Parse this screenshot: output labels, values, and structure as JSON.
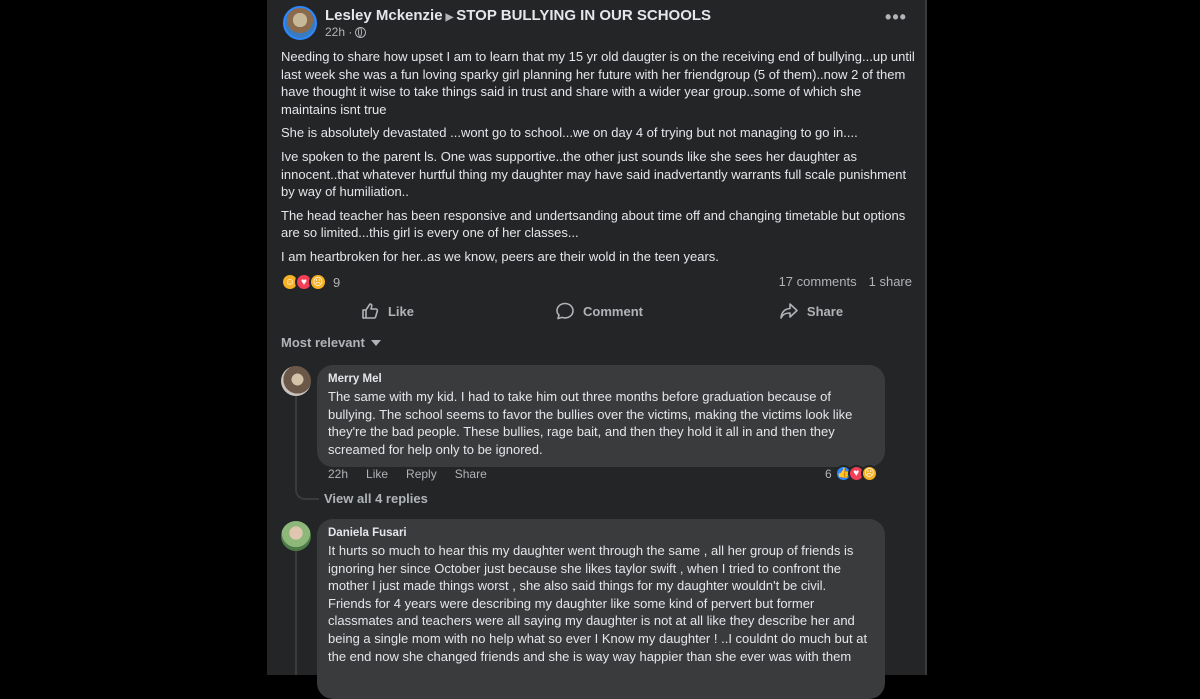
{
  "post": {
    "author": "Lesley Mckenzie",
    "group": "STOP BULLYING IN OUR SCHOOLS",
    "time": "22h ·",
    "paragraphs": [
      "Needing to share how upset I am to learn that my 15 yr old daugter is on the receiving end of bullying...up until last week she was a fun loving sparky girl planning her future with her friendgroup (5 of them)..now 2 of them have thought it wise to take things said in trust and share with a wider year group..some of which she maintains isnt true",
      "She is absolutely devastated  ...wont go to school...we on day 4 of trying but not managing to go in....",
      "Ive spoken to the parent ls. One was supportive..the other just sounds like she sees her daughter as innocent..that whatever hurtful thing my daughter may have said inadvertantly warrants full scale punishment by way of humiliation..",
      "The head teacher has been responsive and  undertsanding about time off and changing timetable but options are so limited...this girl is every one of her classes...",
      "I am heartbroken for her..as we know, peers are their wold in the teen years."
    ],
    "reaction_count": "9",
    "comments_count": "17 comments",
    "shares_count": "1 share"
  },
  "actions": {
    "like": "Like",
    "comment": "Comment",
    "share": "Share"
  },
  "sort_label": "Most relevant",
  "comments": [
    {
      "name": "Merry Mel",
      "text": "The same with my kid. I had to take him out three months before graduation because of bullying. The school seems to favor the bullies over the victims, making the victims look like they're the bad people. These bullies, rage bait, and then they hold it all in and then they screamed for help only to be ignored.",
      "time": "22h",
      "like": "Like",
      "reply": "Reply",
      "share": "Share",
      "reaction_count": "6",
      "replies_link": "View all 4 replies"
    },
    {
      "name": "Daniela Fusari",
      "text": "It hurts so much to hear this my daughter went through the same , all her group of friends is ignoring her since October just because she likes taylor swift , when I tried to confront the mother I just made things worst , she also said things for my daughter wouldn't be civil. Friends for 4 years were describing my daughter like some kind of pervert but former classmates and teachers were all saying my daughter is not at all like they describe her and being a single mom with no help what so ever I Know my daughter ! ..I couldnt do much but at the end now she changed friends and she is way way happier than she ever was with them"
    }
  ],
  "colors": {
    "card": "#242526",
    "bubble": "#3a3b3c",
    "text": "#e4e6eb",
    "muted": "#b0b3b8",
    "like": "#2d88ff",
    "love": "#f33e58",
    "sad": "#f7b125"
  },
  "icons": [
    "more-icon",
    "globe-icon",
    "like-icon",
    "comment-icon",
    "share-icon",
    "caret-down-icon"
  ]
}
